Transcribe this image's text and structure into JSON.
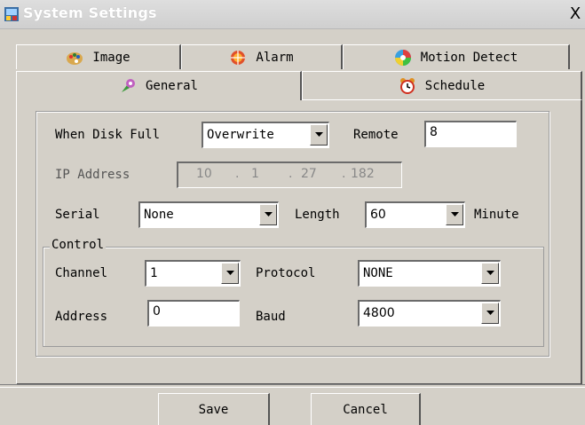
{
  "window": {
    "title": "System Settings",
    "close_glyph": "X"
  },
  "tabs": {
    "back_row": [
      {
        "label": "Image",
        "icon": "image-palette-icon"
      },
      {
        "label": "Alarm",
        "icon": "alarm-icon"
      },
      {
        "label": "Motion Detect",
        "icon": "motion-detect-icon"
      }
    ],
    "front_row": [
      {
        "label": "General",
        "icon": "general-icon",
        "selected": true
      },
      {
        "label": "Schedule",
        "icon": "schedule-clock-icon",
        "selected": false
      }
    ]
  },
  "general": {
    "disk_full_label": "When Disk Full",
    "disk_full_value": "Overwrite",
    "remote_label": "Remote",
    "remote_value": "8",
    "ip_label": "IP Address",
    "ip_octets": [
      "10",
      "1",
      "27",
      "182"
    ],
    "ip_dot": ".",
    "serial_label": "Serial",
    "serial_value": "None",
    "length_label": "Length",
    "length_value": "60",
    "length_unit": "Minute"
  },
  "control": {
    "legend": "Control",
    "channel_label": "Channel",
    "channel_value": "1",
    "protocol_label": "Protocol",
    "protocol_value": "NONE",
    "address_label": "Address",
    "address_value": "0",
    "baud_label": "Baud",
    "baud_value": "4800"
  },
  "buttons": {
    "save": "Save",
    "cancel": "Cancel"
  },
  "colors": {
    "face": "#d4d0c8",
    "shadow": "#555555",
    "highlight": "#ffffff"
  }
}
